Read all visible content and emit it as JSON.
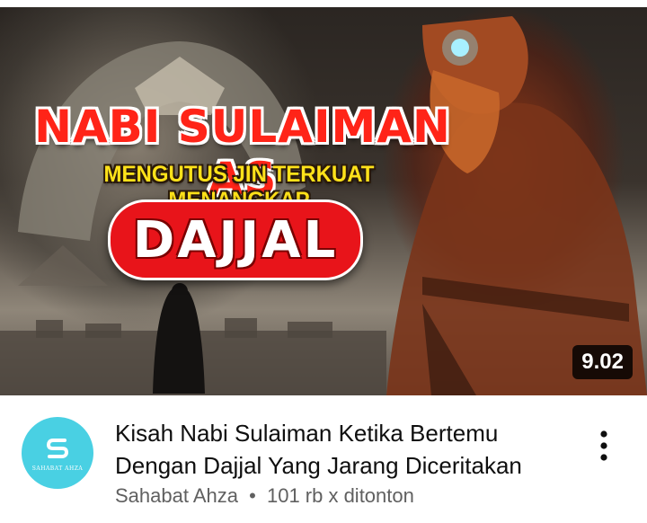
{
  "video": {
    "thumbnail": {
      "headline_line1": "NABI SULAIMAN AS",
      "headline_line2": "MENGUTUS JIN TERKUAT MENANGKAP",
      "headline_line3": "DAJJAL",
      "duration": "9.02"
    },
    "title_line1": "Kisah Nabi Sulaiman Ketika Bertemu",
    "title_line2": "Dengan Dajjal Yang Jarang Diceritakan",
    "channel_name": "Sahabat Ahza",
    "meta_separator": "•",
    "views": "101 rb x ditonton",
    "avatar": {
      "text": "SAHABAT AHZA",
      "color": "#49d0e3",
      "icon": "s-logo-icon"
    },
    "more_icon": "more-vertical-icon"
  }
}
